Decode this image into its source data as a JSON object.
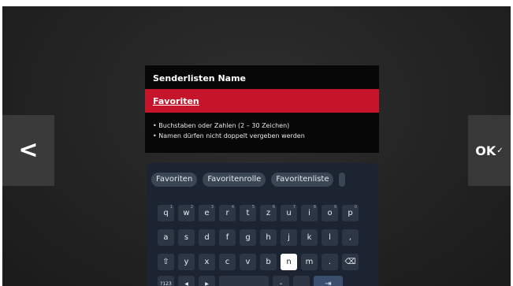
{
  "nav": {
    "back_glyph": "<",
    "ok_label": "OK",
    "ok_check": "✓"
  },
  "dialog": {
    "title": "Senderlisten Name",
    "field_value": "Favoriten",
    "hints": [
      "Buchstaben oder Zahlen (2 – 30 Zeichen)",
      "Namen dürfen nicht doppelt vergeben werden"
    ]
  },
  "keyboard": {
    "suggestions": [
      "Favoriten",
      "Favoritenrolle",
      "Favoritenliste"
    ],
    "row1": [
      {
        "c": "q",
        "h": "1"
      },
      {
        "c": "w",
        "h": "2"
      },
      {
        "c": "e",
        "h": "3"
      },
      {
        "c": "r",
        "h": "4"
      },
      {
        "c": "t",
        "h": "5"
      },
      {
        "c": "z",
        "h": "6"
      },
      {
        "c": "u",
        "h": "7"
      },
      {
        "c": "i",
        "h": "8"
      },
      {
        "c": "o",
        "h": "9"
      },
      {
        "c": "p",
        "h": "0"
      }
    ],
    "row2": [
      "a",
      "s",
      "d",
      "f",
      "g",
      "h",
      "j",
      "k",
      "l",
      ","
    ],
    "row3": [
      "⇧",
      "y",
      "x",
      "c",
      "v",
      "b",
      "n",
      "m",
      ".",
      "⌫"
    ],
    "row4": {
      "symbols": "?123",
      "left": "◀",
      "right": "▶",
      "space": "⎵",
      "minus": "-",
      "underscore": "_",
      "enter": "⇥"
    }
  }
}
